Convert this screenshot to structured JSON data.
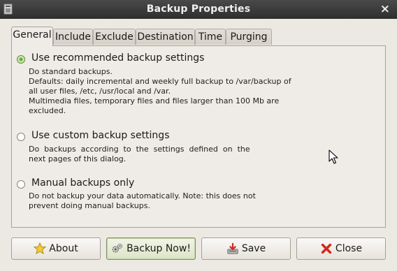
{
  "window": {
    "title": "Backup Properties",
    "close_glyph": "×"
  },
  "tabs": [
    {
      "label": "General",
      "active": true
    },
    {
      "label": "Include"
    },
    {
      "label": "Exclude"
    },
    {
      "label": "Destination"
    },
    {
      "label": "Time"
    },
    {
      "label": "Purging"
    }
  ],
  "options": [
    {
      "label": "Use recommended backup settings",
      "checked": true,
      "description": "Do standard backups.\nDefaults: daily incremental and weekly full backup to /var/backup of\nall user files, /etc, /usr/local and /var.\nMultimedia files, temporary files and files larger than 100 Mb are\nexcluded."
    },
    {
      "label": "Use custom backup settings",
      "checked": false,
      "description": "Do  backups  according  to  the  settings  defined  on  the\nnext pages of this dialog."
    },
    {
      "label": "Manual backups only",
      "checked": false,
      "description": "Do not backup your data automatically. Note: this does not\nprevent doing manual backups."
    }
  ],
  "buttons": {
    "about": {
      "label": "About",
      "icon": "star-icon"
    },
    "backup_now": {
      "label": "Backup Now!",
      "icon": "gears-icon"
    },
    "save": {
      "label": "Save",
      "icon": "save-icon"
    },
    "close": {
      "label": "Close",
      "icon": "close-icon"
    }
  }
}
